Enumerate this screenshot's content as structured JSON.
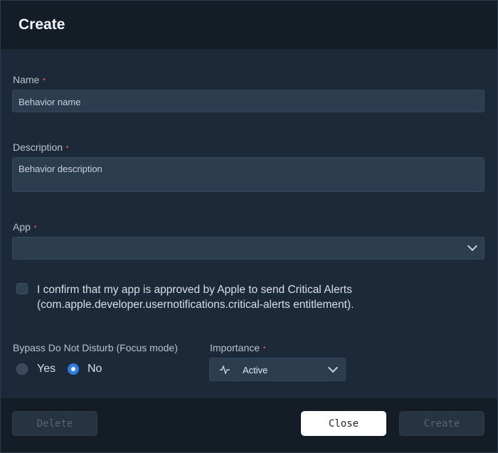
{
  "header": {
    "title": "Create"
  },
  "form": {
    "name": {
      "label": "Name",
      "required_mark": "•",
      "placeholder": "Behavior name"
    },
    "description": {
      "label": "Description",
      "required_mark": "•",
      "placeholder": "Behavior description"
    },
    "app": {
      "label": "App",
      "required_mark": "•",
      "value": ""
    },
    "confirm": {
      "text": "I confirm that my app is approved by Apple to send Critical Alerts (com.apple.developer.usernotifications.critical-alerts entitlement).",
      "checked": false
    },
    "bypass": {
      "label": "Bypass Do Not Disturb (Focus mode)",
      "options": [
        "Yes",
        "No"
      ],
      "selected": "No"
    },
    "importance": {
      "label": "Importance",
      "required_mark": "•",
      "value": "Active",
      "icon": "activity-pulse-icon"
    }
  },
  "footer": {
    "delete_label": "Delete",
    "close_label": "Close",
    "create_label": "Create"
  },
  "colors": {
    "accent": "#2f7de1",
    "required": "#d9534f",
    "surface": "#1c2939",
    "field": "#2c3d50"
  }
}
